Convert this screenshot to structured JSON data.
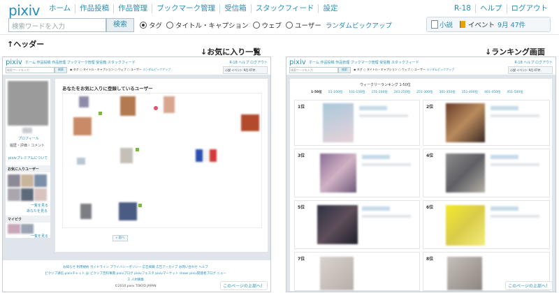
{
  "header": {
    "logo": "pixiv",
    "nav": [
      "ホーム",
      "作品投稿",
      "作品管理",
      "ブックマーク管理",
      "受信箱",
      "スタックフィード",
      "設定"
    ],
    "right_nav": [
      "R-18",
      "ヘルプ",
      "ログアウト"
    ],
    "search_placeholder": "検索ワードを入力",
    "search_button": "検索",
    "radios": [
      {
        "label": "タグ",
        "checked": true
      },
      {
        "label": "タイトル・キャプション",
        "checked": false
      },
      {
        "label": "ウェブ",
        "checked": false
      },
      {
        "label": "ユーザー",
        "checked": false
      }
    ],
    "random_pickup": "ランダムピックアップ",
    "novel": "小説",
    "event_label": "イベント",
    "event_date": "9月 47件"
  },
  "annotations": {
    "header": "↑ヘッダー",
    "favorites": "↓お気に入り一覧",
    "ranking": "↓ランキング画面"
  },
  "favorites_panel": {
    "title": "あなたをお気に入りに登録しているユーザー",
    "profile_link": "プロフィール",
    "history_link": "履歴・評価・コメント",
    "premium_link": "pixivプレミアムについて",
    "fav_users_heading": "お気に入りユーザー",
    "see_all": "一覧を見る",
    "your_fans": "あなたを見る",
    "mypick_heading": "マイピク",
    "mypick_all": "一覧を見る",
    "next_button": "« 前へ",
    "footer_links": [
      "お知らせ",
      "利用規約",
      "ガイドライン",
      "プライバシーポリシー",
      "広告掲載",
      "広告アーカイブ",
      "お問い合わせ",
      "ヘルプ",
      "ピクシブ通信",
      "pixivチャット",
      "jiji",
      "ピクシブ百科事典",
      "pixivブログ",
      "pixivフェスタ",
      "pixivマーケット",
      "drawr",
      "pixiv開発者ブログ",
      "ニュース",
      "人材募集"
    ],
    "copyright": "©2010 pixiv TOKYO JAPAN",
    "to_top": "このページの上部へ！"
  },
  "ranking_panel": {
    "title": "ウィークリーランキング 1-50位",
    "ranges": [
      "1-50位",
      "51-100位",
      "101-150位",
      "151-200位",
      "201-250位",
      "251-300位",
      "301-350位",
      "351-400位",
      "401-450位",
      "451-500位"
    ],
    "ranks": [
      "1位",
      "2位",
      "3位",
      "4位",
      "5位",
      "6位",
      "7位",
      "8位"
    ],
    "to_top": "このページの上部へ！"
  }
}
